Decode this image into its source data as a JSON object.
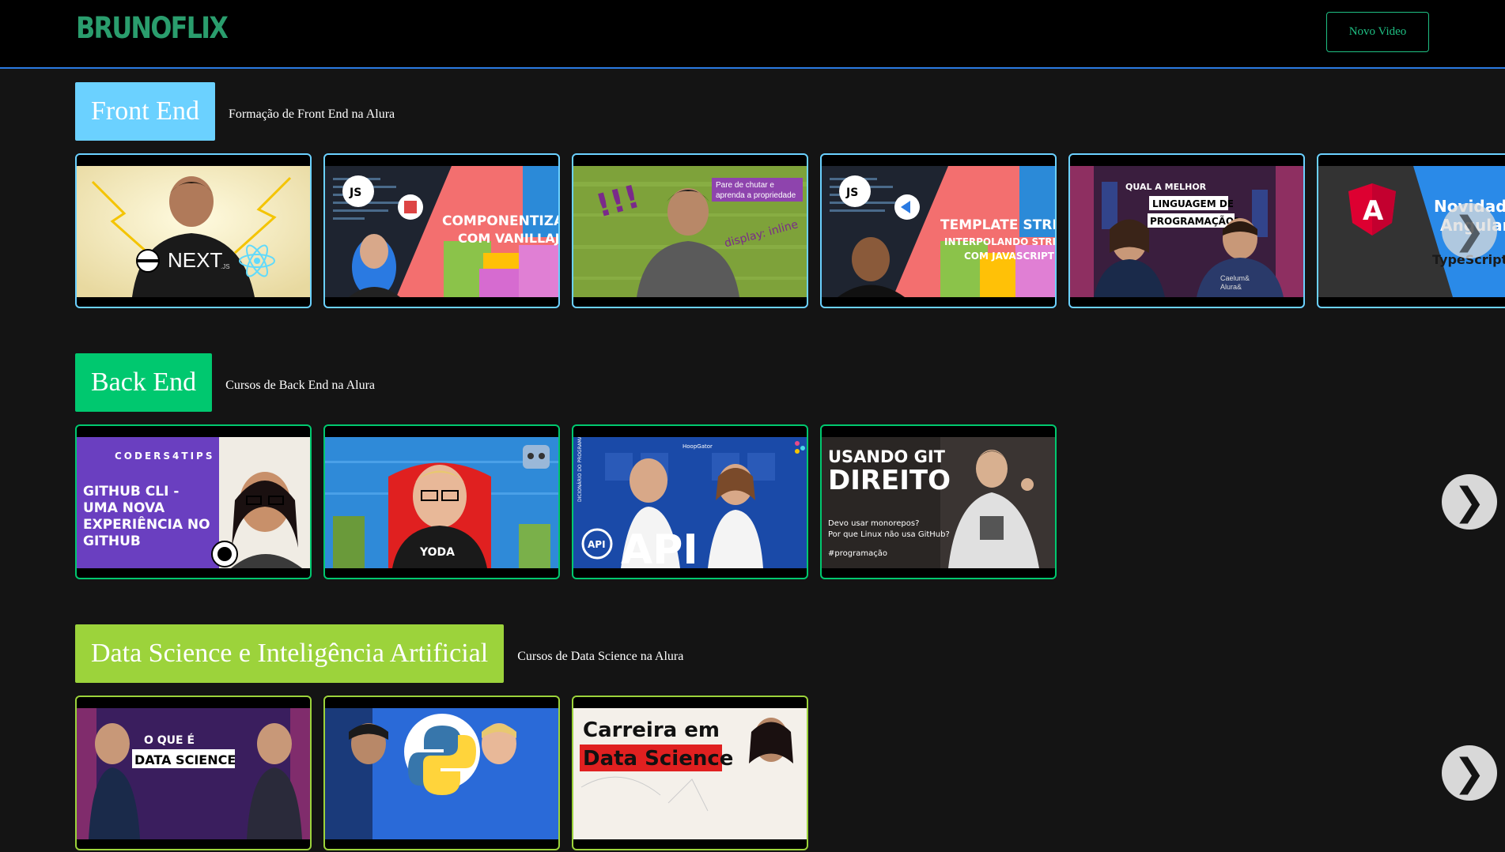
{
  "header": {
    "logo": "BRUNOFLIX",
    "new_video_label": "Novo Video"
  },
  "categories": [
    {
      "title": "Front End",
      "description": "Formação de Front End na Alura",
      "color": "#6bd1ff",
      "videos": [
        {
          "thumb_text": "NEXT.JS"
        },
        {
          "thumb_text": "COMPONENTIZAÇÃO COM VANILLAJS"
        },
        {
          "thumb_text": "Pare de chutar e aprenda a propriedade display: inline"
        },
        {
          "thumb_text": "TEMPLATE STRING: INTERPOLANDO STRINGS COM JAVASCRIPT"
        },
        {
          "thumb_text": "QUAL A MELHOR LINGUAGEM DE PROGRAMAÇÃO?"
        },
        {
          "thumb_text": "Novidades Angular v TypeScript"
        }
      ]
    },
    {
      "title": "Back End",
      "description": "Cursos de Back End na Alura",
      "color": "#00c86f",
      "videos": [
        {
          "thumb_text": "CODERS4TIPS GITHUB CLI - UMA NOVA EXPERIÊNCIA NO GITHUB"
        },
        {
          "thumb_text": "YODA"
        },
        {
          "thumb_text": "DICIONÁRIO DO PROGRAMADOR API"
        },
        {
          "thumb_text": "USANDO GIT DIREITO Devo usar monorepos? Por que Linux não usa GitHub? #programação"
        }
      ]
    },
    {
      "title": "Data Science e Inteligência Artificial",
      "description": "Cursos de Data Science na Alura",
      "color": "#9cd33b",
      "videos": [
        {
          "thumb_text": "O QUE É DATA SCIENCE"
        },
        {
          "thumb_text": "Python"
        },
        {
          "thumb_text": "Carreira em Data Science"
        }
      ]
    }
  ],
  "icons": {
    "next_arrow": "chevron-right-icon"
  }
}
